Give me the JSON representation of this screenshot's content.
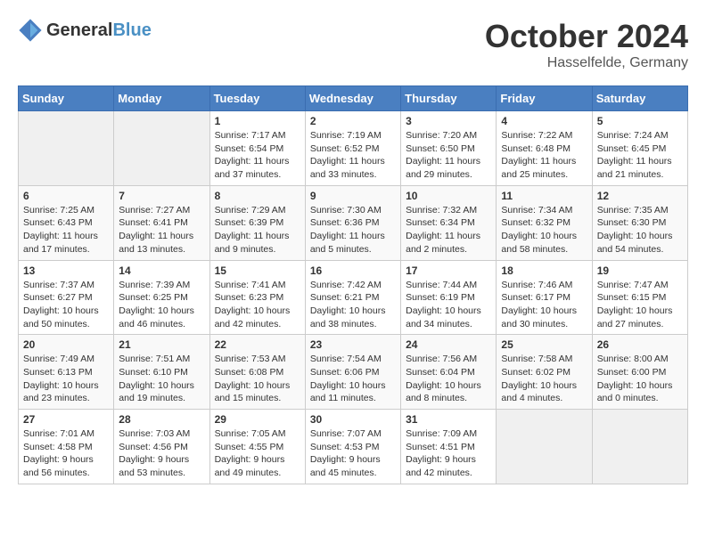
{
  "header": {
    "logo_general": "General",
    "logo_blue": "Blue",
    "month_title": "October 2024",
    "location": "Hasselfelde, Germany"
  },
  "days_of_week": [
    "Sunday",
    "Monday",
    "Tuesday",
    "Wednesday",
    "Thursday",
    "Friday",
    "Saturday"
  ],
  "weeks": [
    [
      {
        "day": "",
        "info": ""
      },
      {
        "day": "",
        "info": ""
      },
      {
        "day": "1",
        "info": "Sunrise: 7:17 AM\nSunset: 6:54 PM\nDaylight: 11 hours and 37 minutes."
      },
      {
        "day": "2",
        "info": "Sunrise: 7:19 AM\nSunset: 6:52 PM\nDaylight: 11 hours and 33 minutes."
      },
      {
        "day": "3",
        "info": "Sunrise: 7:20 AM\nSunset: 6:50 PM\nDaylight: 11 hours and 29 minutes."
      },
      {
        "day": "4",
        "info": "Sunrise: 7:22 AM\nSunset: 6:48 PM\nDaylight: 11 hours and 25 minutes."
      },
      {
        "day": "5",
        "info": "Sunrise: 7:24 AM\nSunset: 6:45 PM\nDaylight: 11 hours and 21 minutes."
      }
    ],
    [
      {
        "day": "6",
        "info": "Sunrise: 7:25 AM\nSunset: 6:43 PM\nDaylight: 11 hours and 17 minutes."
      },
      {
        "day": "7",
        "info": "Sunrise: 7:27 AM\nSunset: 6:41 PM\nDaylight: 11 hours and 13 minutes."
      },
      {
        "day": "8",
        "info": "Sunrise: 7:29 AM\nSunset: 6:39 PM\nDaylight: 11 hours and 9 minutes."
      },
      {
        "day": "9",
        "info": "Sunrise: 7:30 AM\nSunset: 6:36 PM\nDaylight: 11 hours and 5 minutes."
      },
      {
        "day": "10",
        "info": "Sunrise: 7:32 AM\nSunset: 6:34 PM\nDaylight: 11 hours and 2 minutes."
      },
      {
        "day": "11",
        "info": "Sunrise: 7:34 AM\nSunset: 6:32 PM\nDaylight: 10 hours and 58 minutes."
      },
      {
        "day": "12",
        "info": "Sunrise: 7:35 AM\nSunset: 6:30 PM\nDaylight: 10 hours and 54 minutes."
      }
    ],
    [
      {
        "day": "13",
        "info": "Sunrise: 7:37 AM\nSunset: 6:27 PM\nDaylight: 10 hours and 50 minutes."
      },
      {
        "day": "14",
        "info": "Sunrise: 7:39 AM\nSunset: 6:25 PM\nDaylight: 10 hours and 46 minutes."
      },
      {
        "day": "15",
        "info": "Sunrise: 7:41 AM\nSunset: 6:23 PM\nDaylight: 10 hours and 42 minutes."
      },
      {
        "day": "16",
        "info": "Sunrise: 7:42 AM\nSunset: 6:21 PM\nDaylight: 10 hours and 38 minutes."
      },
      {
        "day": "17",
        "info": "Sunrise: 7:44 AM\nSunset: 6:19 PM\nDaylight: 10 hours and 34 minutes."
      },
      {
        "day": "18",
        "info": "Sunrise: 7:46 AM\nSunset: 6:17 PM\nDaylight: 10 hours and 30 minutes."
      },
      {
        "day": "19",
        "info": "Sunrise: 7:47 AM\nSunset: 6:15 PM\nDaylight: 10 hours and 27 minutes."
      }
    ],
    [
      {
        "day": "20",
        "info": "Sunrise: 7:49 AM\nSunset: 6:13 PM\nDaylight: 10 hours and 23 minutes."
      },
      {
        "day": "21",
        "info": "Sunrise: 7:51 AM\nSunset: 6:10 PM\nDaylight: 10 hours and 19 minutes."
      },
      {
        "day": "22",
        "info": "Sunrise: 7:53 AM\nSunset: 6:08 PM\nDaylight: 10 hours and 15 minutes."
      },
      {
        "day": "23",
        "info": "Sunrise: 7:54 AM\nSunset: 6:06 PM\nDaylight: 10 hours and 11 minutes."
      },
      {
        "day": "24",
        "info": "Sunrise: 7:56 AM\nSunset: 6:04 PM\nDaylight: 10 hours and 8 minutes."
      },
      {
        "day": "25",
        "info": "Sunrise: 7:58 AM\nSunset: 6:02 PM\nDaylight: 10 hours and 4 minutes."
      },
      {
        "day": "26",
        "info": "Sunrise: 8:00 AM\nSunset: 6:00 PM\nDaylight: 10 hours and 0 minutes."
      }
    ],
    [
      {
        "day": "27",
        "info": "Sunrise: 7:01 AM\nSunset: 4:58 PM\nDaylight: 9 hours and 56 minutes."
      },
      {
        "day": "28",
        "info": "Sunrise: 7:03 AM\nSunset: 4:56 PM\nDaylight: 9 hours and 53 minutes."
      },
      {
        "day": "29",
        "info": "Sunrise: 7:05 AM\nSunset: 4:55 PM\nDaylight: 9 hours and 49 minutes."
      },
      {
        "day": "30",
        "info": "Sunrise: 7:07 AM\nSunset: 4:53 PM\nDaylight: 9 hours and 45 minutes."
      },
      {
        "day": "31",
        "info": "Sunrise: 7:09 AM\nSunset: 4:51 PM\nDaylight: 9 hours and 42 minutes."
      },
      {
        "day": "",
        "info": ""
      },
      {
        "day": "",
        "info": ""
      }
    ]
  ]
}
